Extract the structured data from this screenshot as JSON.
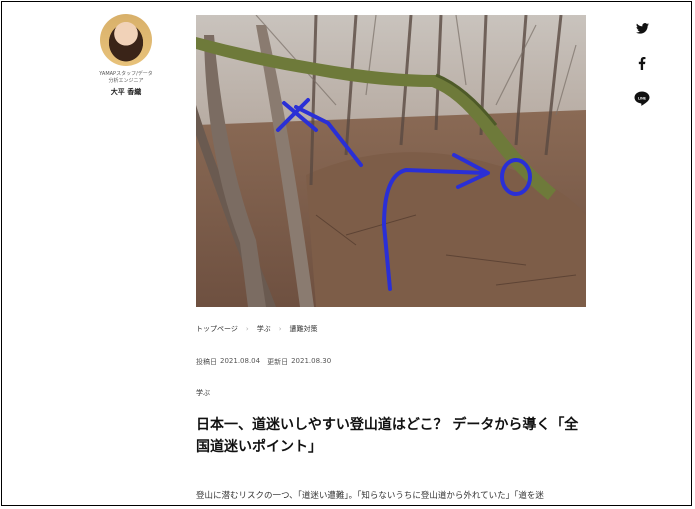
{
  "author": {
    "badge": "!",
    "role": "YAMAPスタッフ/データ\n分析エンジニア",
    "name": "大平 香織"
  },
  "hero": {
    "icon": "trail-photo-with-route-marks",
    "colors": {
      "marker": "#2a2fd6",
      "ground": "#7a5a45",
      "moss": "#6e7a3a"
    }
  },
  "breadcrumb": {
    "items": [
      "トップページ",
      "学ぶ",
      "遭難対策"
    ]
  },
  "dates": {
    "published_label": "投稿日",
    "published": "2021.08.04",
    "updated_label": "更新日",
    "updated": "2021.08.30"
  },
  "category": "学ぶ",
  "title": "日本一、道迷いしやすい登山道はどこ？ データから導く「全国道迷いポイント」",
  "lead": "登山に潜むリスクの一つ、「道迷い遭難」。「知らないうちに登山道から外れていた」「道を迷",
  "share": {
    "icons": [
      "twitter-icon",
      "facebook-icon",
      "line-icon"
    ],
    "line_label": "LINE"
  }
}
